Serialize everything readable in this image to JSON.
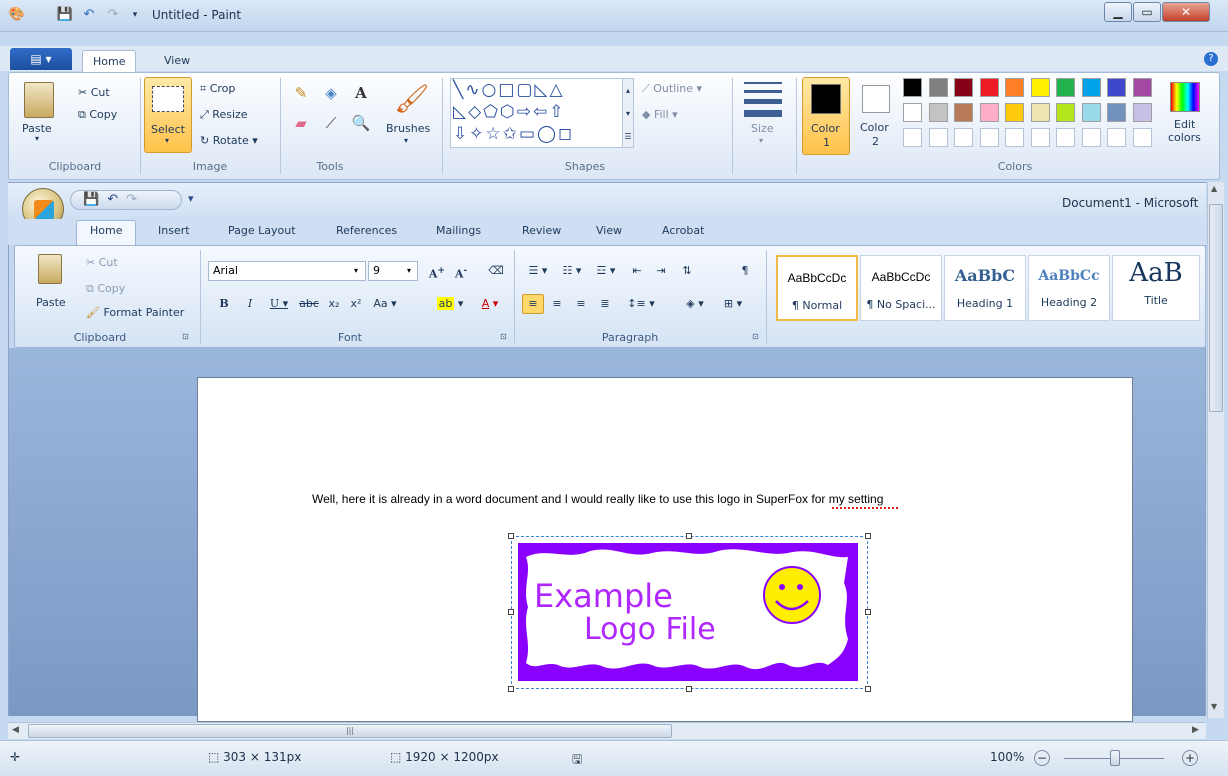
{
  "paint": {
    "title": "Untitled - Paint",
    "tabs": [
      {
        "label": "Home"
      },
      {
        "label": "View"
      }
    ],
    "clipboard": {
      "paste": "Paste",
      "cut": "Cut",
      "copy": "Copy",
      "group": "Clipboard"
    },
    "image": {
      "select": "Select",
      "crop": "Crop",
      "resize": "Resize",
      "rotate": "Rotate",
      "group": "Image"
    },
    "tools": {
      "group": "Tools"
    },
    "brushes": {
      "label": "Brushes"
    },
    "shapes": {
      "outline": "Outline",
      "fill": "Fill",
      "group": "Shapes"
    },
    "size": {
      "label": "Size"
    },
    "colors": {
      "color1": "Color",
      "color1_num": "1",
      "color2": "Color",
      "color2_num": "2",
      "edit_line1": "Edit",
      "edit_line2": "colors",
      "group": "Colors",
      "row1": [
        "#000000",
        "#7f7f7f",
        "#880015",
        "#ed1c24",
        "#ff7f27",
        "#fff200",
        "#22b14c",
        "#00a2e8",
        "#3f48cc",
        "#a349a4"
      ],
      "row2": [
        "#ffffff",
        "#c3c3c3",
        "#b97a57",
        "#ffaec9",
        "#ffc90e",
        "#efe4b0",
        "#b5e61d",
        "#99d9ea",
        "#7092be",
        "#c8bfe7"
      ]
    }
  },
  "word": {
    "title": "Document1 - Microsoft",
    "tabs": [
      "Home",
      "Insert",
      "Page Layout",
      "References",
      "Mailings",
      "Review",
      "View",
      "Acrobat"
    ],
    "clipboard": {
      "paste": "Paste",
      "cut": "Cut",
      "copy": "Copy",
      "format_painter": "Format Painter",
      "group": "Clipboard"
    },
    "font": {
      "name": "Arial",
      "size": "9",
      "group": "Font"
    },
    "paragraph": {
      "group": "Paragraph"
    },
    "styles": [
      {
        "preview": "AaBbCcDc",
        "name": "¶ Normal"
      },
      {
        "preview": "AaBbCcDc",
        "name": "¶ No Spaci..."
      },
      {
        "preview": "AaBbC",
        "name": "Heading 1"
      },
      {
        "preview": "AaBbCc",
        "name": "Heading 2"
      },
      {
        "preview": "AaB",
        "name": "Title"
      }
    ],
    "document_text": "Well, here it is already in a word document and I  would really like to use this logo in SuperFox for my setting",
    "logo": {
      "line1": "Example",
      "line2": "Logo File"
    }
  },
  "status": {
    "selection_size": "303 × 131px",
    "image_size": "1920 × 1200px",
    "zoom": "100%"
  },
  "accent": {
    "purple": "#8a00ff",
    "smiley": "#ffee00",
    "logo_text": "#b026ff"
  }
}
